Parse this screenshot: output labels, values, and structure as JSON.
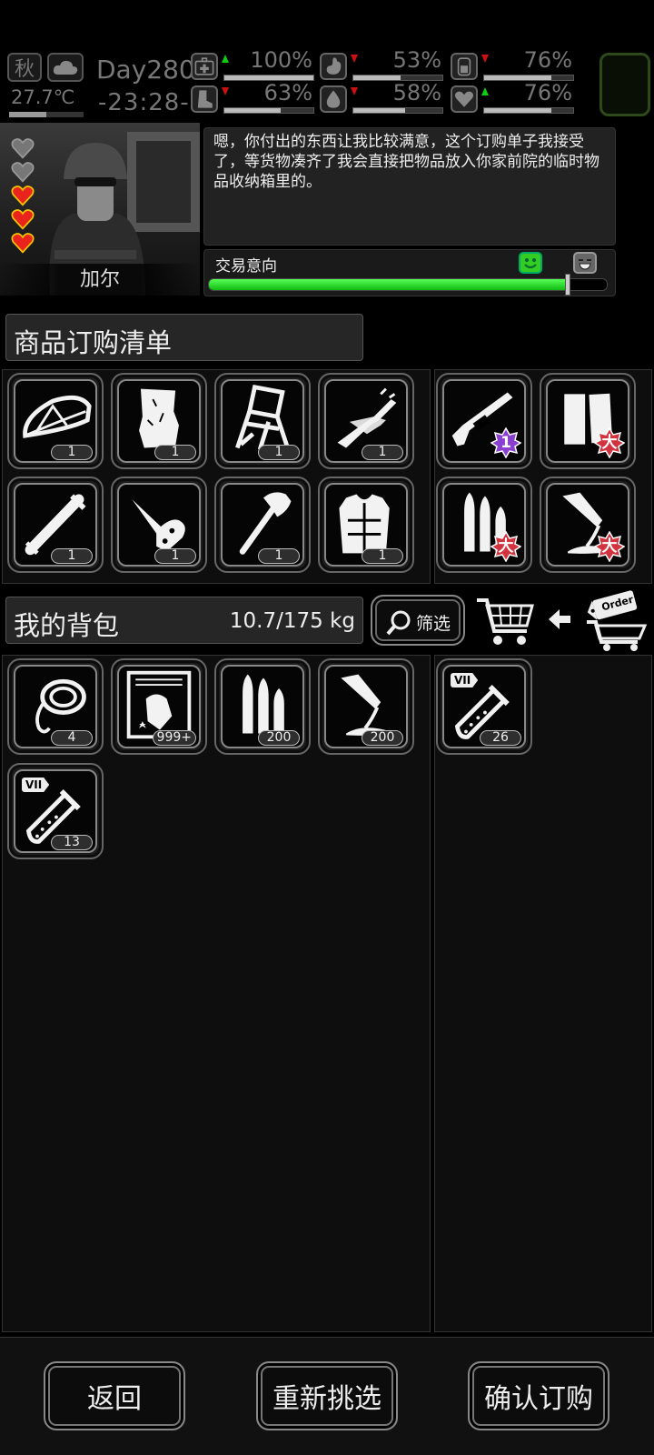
{
  "status": {
    "season": "秋",
    "temperature": "27.7℃",
    "day": "Day280",
    "time": "-23:28-",
    "stats": [
      {
        "icon": "medkit-icon",
        "value": "100%",
        "trend": "up",
        "level": 1.0
      },
      {
        "icon": "stomach-icon",
        "value": "53%",
        "trend": "down",
        "level": 0.53
      },
      {
        "icon": "battery-icon",
        "value": "76%",
        "trend": "down",
        "level": 0.76
      },
      {
        "icon": "boot-icon",
        "value": "63%",
        "trend": "down",
        "level": 0.63
      },
      {
        "icon": "water-drop-icon",
        "value": "58%",
        "trend": "down",
        "level": 0.58
      },
      {
        "icon": "heart-icon",
        "value": "76%",
        "trend": "up",
        "level": 0.76
      }
    ]
  },
  "npc": {
    "name": "加尔",
    "hearts_filled": 3,
    "hearts_total": 5,
    "dialog": "嗯，你付出的东西让我比较满意，这个订购单子我接受了，等货物凑齐了我会直接把物品放入你家前院的临时物品收纳箱里的。",
    "intent_label": "交易意向",
    "intent_level": 0.9
  },
  "order": {
    "title": "商品订购清单",
    "left_items": [
      {
        "icon": "tent-icon",
        "qty": "1"
      },
      {
        "icon": "cardboard-icon",
        "qty": "1"
      },
      {
        "icon": "folding-chair-icon",
        "qty": "1"
      },
      {
        "icon": "rifles-icon",
        "qty": "1"
      },
      {
        "icon": "pipe-icon",
        "qty": "1"
      },
      {
        "icon": "pocket-knife-icon",
        "qty": "1"
      },
      {
        "icon": "axe-icon",
        "qty": "1"
      },
      {
        "icon": "vest-icon",
        "qty": "1"
      }
    ],
    "right_items": [
      {
        "icon": "shotgun-icon",
        "badge": "1",
        "badge_color": "#8a3fd0"
      },
      {
        "icon": "planks-icon",
        "badge": "大",
        "badge_color": "#d2343f"
      },
      {
        "icon": "ammo-icon",
        "badge": "大",
        "badge_color": "#d2343f"
      },
      {
        "icon": "flask-pour-icon",
        "badge": "大",
        "badge_color": "#d2343f"
      }
    ]
  },
  "backpack": {
    "title": "我的背包",
    "weight": "10.7/175 kg",
    "filter_label": "筛选",
    "left_items": [
      {
        "icon": "rope-icon",
        "qty": "4"
      },
      {
        "icon": "zombie-card-icon",
        "qty": "999+"
      },
      {
        "icon": "ammo-icon",
        "qty": "200"
      },
      {
        "icon": "flask-pour-icon",
        "qty": "200"
      },
      {
        "icon": "test-tube-icon",
        "qty": "13",
        "tag": "VII"
      }
    ],
    "right_items": [
      {
        "icon": "test-tube-icon",
        "qty": "26",
        "tag": "VII"
      }
    ]
  },
  "order_tag": "Order",
  "buttons": {
    "back": "返回",
    "reselect": "重新挑选",
    "confirm": "确认订购"
  }
}
